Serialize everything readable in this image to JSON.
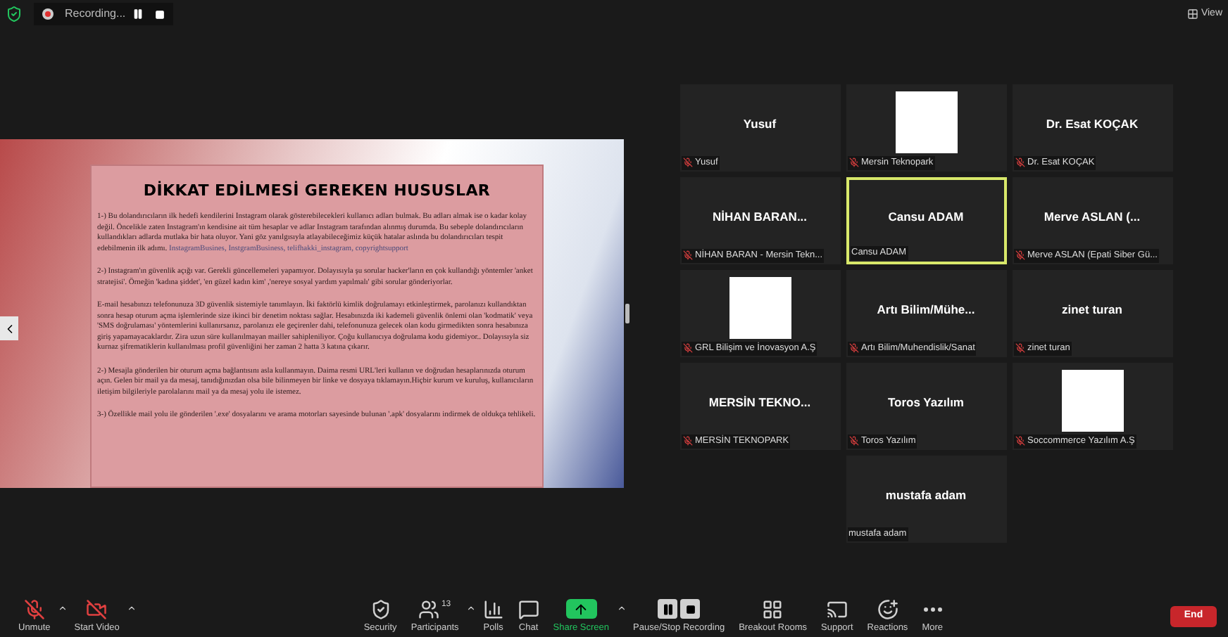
{
  "top_bar": {
    "recording_label": "Recording...",
    "view_label": "View"
  },
  "slide": {
    "title": "DİKKAT EDİLMESİ GEREKEN HUSUSLAR",
    "paragraphs": [
      {
        "text": "1-) Bu dolandırıcıların ilk hedefi kendilerini Instagram olarak gösterebilecekleri kullanıcı adları bulmak. Bu adları almak ise o kadar kolay değil. Öncelikle zaten Instagram'ın kendisine ait tüm hesaplar ve adlar Instagram tarafından alınmış durumda. Bu sebeple dolandırıcıların kullandıkları adlarda mutlaka bir hata oluyor. Yani göz yanılgısıyla atlayabileceğimiz küçük hatalar aslında bu dolandırıcıları tespit edebilmenin ilk adımı.",
        "note": "InstagramBusines, InstgramBusiness, telifhakki_instagram, copyrightsupport"
      },
      {
        "text": "2-) Instagram'ın güvenlik açığı var. Gerekli güncellemeleri yapamıyor. Dolayısıyla şu sorular hacker'ların en çok kullandığı yöntemler 'anket stratejisi'. Örneğin 'kadına şiddet', 'en güzel kadın kim' ,'nereye sosyal yardım yapılmalı' gibi sorular gönderiyorlar."
      },
      {
        "text": "E-mail hesabınızı telefonunuza 3D güvenlik sistemiyle tanımlayın. İki faktörlü kimlik doğrulamayı etkinleştirmek, parolanızı kullandıktan sonra hesap oturum açma işlemlerinde size ikinci bir denetim noktası sağlar. Hesabınızda iki kademeli güvenlik önlemi olan 'kodmatik' veya 'SMS doğrulaması' yöntemlerini kullanırsanız, parolanızı ele geçirenler dahi, telefonunuza gelecek olan kodu girmedikten sonra hesabınıza giriş yapamayacaklardır. Zira uzun süre kullanılmayan mailler sahipleniliyor. Çoğu kullanıcıya doğrulama kodu gidemiyor.. Dolayısıyla siz kurnaz şifrematiklerin kullanılması profil güvenliğini her zaman 2 hatta 3 katına çıkarır."
      },
      {
        "text": "2-) Mesajla gönderilen bir oturum açma bağlantısını asla kullanmayın. Daima resmi URL'leri kullanın ve doğrudan hesaplarınızda oturum açın. Gelen bir mail ya da mesaj, tanıdığınızdan olsa bile bilinmeyen bir linke ve dosyaya tıklamayın.Hiçbir kurum ve kuruluş, kullanıcıların iletişim bilgileriyle parolalarını mail ya da mesaj yolu ile istemez."
      },
      {
        "text": "3-) Özellikle mail yolu ile gönderilen '.exe' dosyalarını ve arama motorları sayesinde bulunan '.apk' dosyalarını indirmek de oldukça tehlikeli."
      }
    ]
  },
  "gallery": [
    {
      "kind": "name",
      "title": "Yusuf",
      "label": "Yusuf",
      "muted": true,
      "active": false
    },
    {
      "kind": "logo",
      "label": "Mersin Teknopark",
      "muted": true,
      "active": false
    },
    {
      "kind": "name",
      "title": "Dr. Esat KOÇAK",
      "label": "Dr. Esat KOÇAK",
      "muted": true,
      "active": false
    },
    {
      "kind": "name",
      "title": "NİHAN BARAN...",
      "label": "NİHAN BARAN - Mersin Tekn...",
      "muted": true,
      "active": false
    },
    {
      "kind": "name",
      "title": "Cansu ADAM",
      "label": "Cansu ADAM",
      "muted": false,
      "active": true
    },
    {
      "kind": "name",
      "title": "Merve ASLAN (...",
      "label": "Merve ASLAN (Epati Siber Gü...",
      "muted": true,
      "active": false
    },
    {
      "kind": "logo",
      "label": "GRL Bilişim ve İnovasyon A.Ş",
      "muted": true,
      "active": false
    },
    {
      "kind": "name",
      "title": "Artı  Bilim/Mühe...",
      "label": "Artı Bilim/Muhendislik/Sanat",
      "muted": true,
      "active": false
    },
    {
      "kind": "name",
      "title": "zinet turan",
      "label": "zinet turan",
      "muted": true,
      "active": false
    },
    {
      "kind": "name",
      "title": "MERSİN  TEKNO...",
      "label": "MERSİN TEKNOPARK",
      "muted": true,
      "active": false
    },
    {
      "kind": "name",
      "title": "Toros Yazılım",
      "label": "Toros Yazılım",
      "muted": true,
      "active": false
    },
    {
      "kind": "logo",
      "label": "Soccommerce Yazılım A.Ş",
      "muted": true,
      "active": false
    },
    {
      "kind": "name",
      "title": "mustafa adam",
      "label": "mustafa adam",
      "muted": false,
      "active": false
    }
  ],
  "toolbar": [
    {
      "kind": "mic",
      "label": "Unmute",
      "caret": true
    },
    {
      "kind": "video",
      "label": "Start Video",
      "caret": true
    },
    {
      "kind": "security",
      "label": "Security",
      "caret": false
    },
    {
      "kind": "participants",
      "label": "Participants",
      "count": "13",
      "caret": true
    },
    {
      "kind": "polls",
      "label": "Polls",
      "caret": false
    },
    {
      "kind": "chat",
      "label": "Chat",
      "caret": false
    },
    {
      "kind": "share",
      "label": "Share Screen",
      "caret": true
    },
    {
      "kind": "record",
      "label": "Pause/Stop Recording",
      "caret": false
    },
    {
      "kind": "breakout",
      "label": "Breakout Rooms",
      "caret": false
    },
    {
      "kind": "support",
      "label": "Support",
      "caret": false
    },
    {
      "kind": "reactions",
      "label": "Reactions",
      "caret": false
    },
    {
      "kind": "more",
      "label": "More",
      "caret": false
    }
  ],
  "end_button": "End"
}
